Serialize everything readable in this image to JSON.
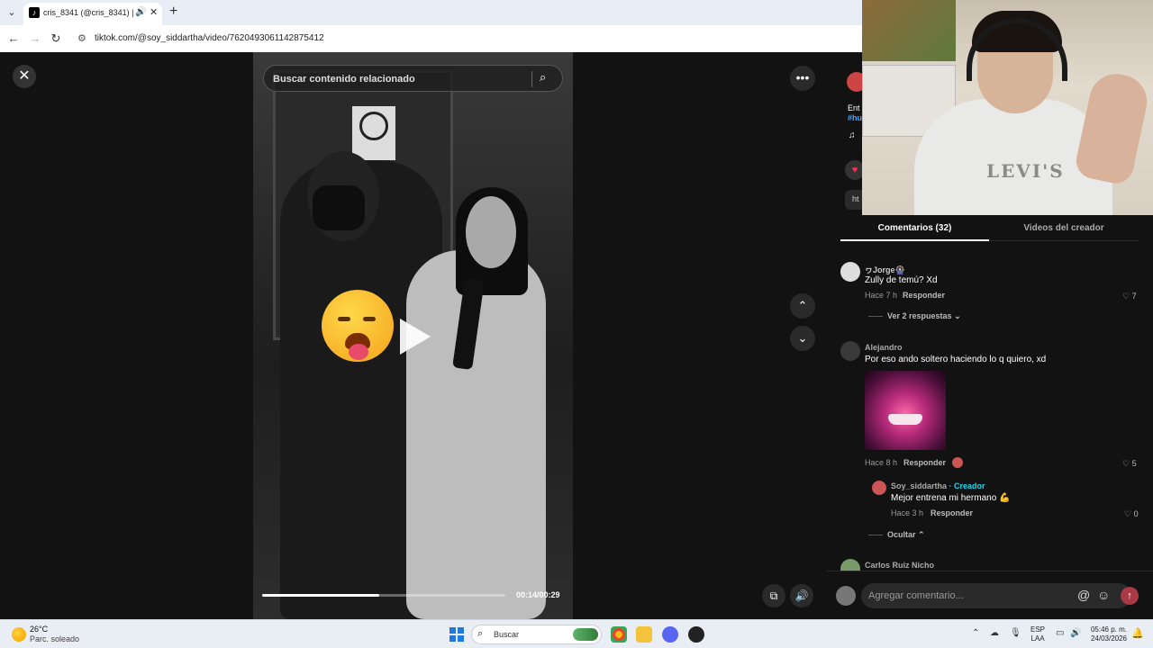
{
  "browser": {
    "tab_title": "cris_8341 (@cris_8341) | TikTok",
    "url": "tiktok.com/@soy_siddartha/video/7620493061142875412"
  },
  "video": {
    "search_placeholder": "Buscar contenido relacionado",
    "time": "00:14/00:29",
    "progress": 0.48
  },
  "panel": {
    "desc_stub": "Ent",
    "desc_tag": "#hu",
    "link_stub": "ht",
    "tabs": [
      "Comentarios (32)",
      "Videos del creador"
    ],
    "comments": [
      {
        "user": "ヮJorge🎡",
        "text": "Zully de temú? Xd",
        "time": "Hace 7 h",
        "reply": "Responder",
        "likes": "7",
        "expand": "Ver 2 respuestas"
      },
      {
        "user": "Alejandro",
        "text": "Por eso ando soltero haciendo lo q quiero, xd",
        "time": "Hace 8 h",
        "reply": "Responder",
        "likes": "5"
      },
      {
        "user": "Soy_siddartha",
        "creator_label": "· Creador",
        "text": "Mejor entrena mi hermano 💪",
        "time": "Hace 3 h",
        "reply": "Responder",
        "likes": "0",
        "collapse": "Ocultar"
      },
      {
        "user": "Carlos Ruiz Nicho"
      }
    ],
    "comment_placeholder": "Agregar comentario..."
  },
  "webcam": {
    "shirt_text": "LEVI'S"
  },
  "taskbar": {
    "temp": "26°C",
    "weather": "Parc. soleado",
    "search": "Buscar",
    "lang1": "ESP",
    "lang2": "LAA",
    "time": "05:46 p. m.",
    "date": "24/03/2026"
  }
}
